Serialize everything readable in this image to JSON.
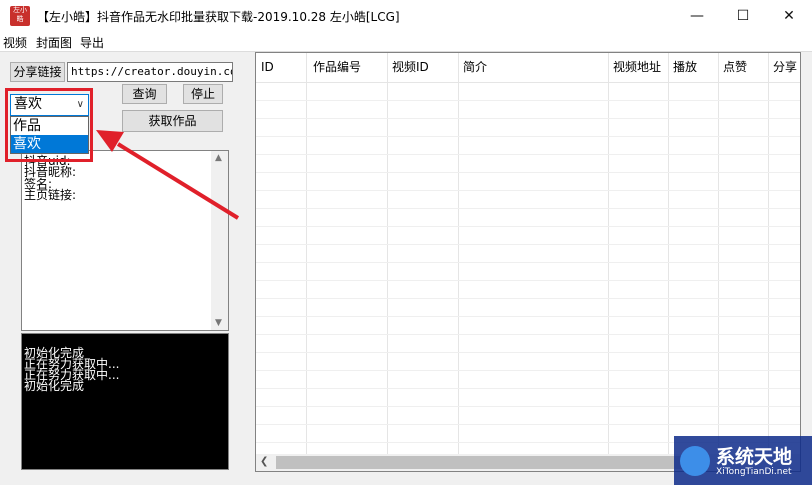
{
  "window": {
    "title": "【左小皓】抖音作品无水印批量获取下载-2019.10.28 左小皓[LCG]",
    "icon_text": "左小皓",
    "minimize_glyph": "—",
    "maximize_glyph": "☐",
    "close_glyph": "✕"
  },
  "menu": [
    "视频",
    "封面图",
    "导出"
  ],
  "controls": {
    "share_link_button": "分享链接",
    "url_value": "https://creator.douyin.com/",
    "query_button": "查询",
    "stop_button": "停止",
    "fetch_works_button": "获取作品",
    "combo_selected": "喜欢",
    "combo_options": [
      "作品",
      "喜欢"
    ]
  },
  "info_panel": {
    "lines": [
      "抖音uid:",
      "抖音昵称:",
      "签名:",
      "主页链接:"
    ]
  },
  "log_panel": {
    "lines": [
      "初始化完成",
      "正在努力获取中...",
      "正在努力获取中...",
      "初始化完成"
    ]
  },
  "table": {
    "columns": [
      "ID",
      "作品编号",
      "视频ID",
      "简介",
      "视频地址",
      "播放",
      "点赞",
      "分享"
    ]
  },
  "watermark": {
    "main": "系统天地",
    "sub": "XiTongTianDi.net"
  },
  "colors": {
    "highlight": "#e0202a",
    "selection": "#0078d7",
    "log_bg": "#000000"
  }
}
